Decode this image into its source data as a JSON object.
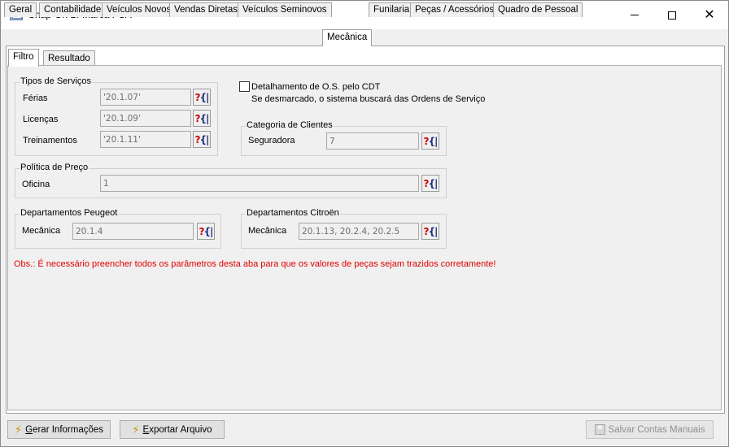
{
  "window": {
    "title": "Snap-On Bi-Marca PSA",
    "minimize": "—",
    "maximize": "□",
    "close": "✕"
  },
  "main_tabs": [
    "Geral",
    "Contabilidade",
    "Veículos Novos",
    "Vendas Diretas",
    "Veículos Seminovos",
    "Mecânica",
    "Funilaria",
    "Peças / Acessórios",
    "Quadro de Pessoal"
  ],
  "active_main_tab": "Mecânica",
  "sub_tabs": [
    "Filtro",
    "Resultado"
  ],
  "active_sub_tab": "Filtro",
  "tipos_servicos": {
    "title": "Tipos de Serviços",
    "ferias_label": "Férias",
    "ferias_value": "'20.1.07'",
    "licencas_label": "Licenças",
    "licencas_value": "'20.1.09'",
    "treinamentos_label": "Treinamentos",
    "treinamentos_value": "'20.1.11'"
  },
  "detalhamento": {
    "label": "Detalhamento de O.S. pelo CDT",
    "hint": "Se desmarcado, o sistema buscará das Ordens de Serviço",
    "checked": false
  },
  "categoria_clientes": {
    "title": "Categoria de Clientes",
    "label": "Seguradora",
    "value": "7"
  },
  "politica_preco": {
    "title": "Política de Preço",
    "label": "Oficina",
    "value": "1"
  },
  "dept_peugeot": {
    "title": "Departamentos Peugeot",
    "label": "Mecânica",
    "value": "20.1.4"
  },
  "dept_citroen": {
    "title": "Departamentos Citroën",
    "label": "Mecânica",
    "value": "20.1.13, 20.2.4, 20.2.5"
  },
  "lookup_glyph_q": "?",
  "lookup_glyph_b": "{|",
  "obs_text": "Obs.: É necessário preencher todos os parâmetros desta aba para que os valores de peças sejam trazidos corretamente!",
  "buttons": {
    "gerar_prefix": "G",
    "gerar_rest": "erar Informações",
    "exportar_prefix": "E",
    "exportar_rest": "xportar Arquivo",
    "salvar": "Salvar Contas Manuais"
  },
  "colors": {
    "obs_text": "#e00000",
    "lookup_question": "#d00000",
    "bolt": "#c89400"
  }
}
